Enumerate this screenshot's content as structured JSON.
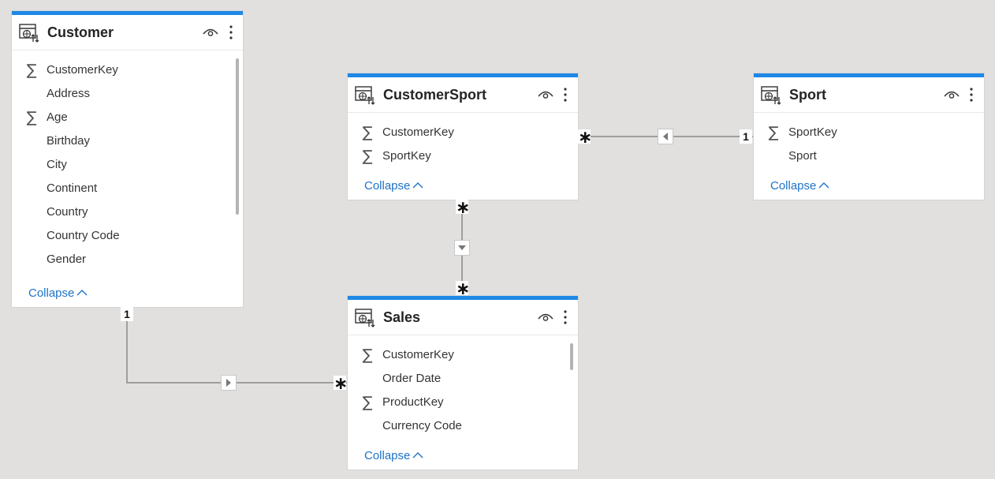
{
  "tables": {
    "customer": {
      "title": "Customer",
      "fields": [
        {
          "name": "CustomerKey",
          "sum": true
        },
        {
          "name": "Address",
          "sum": false
        },
        {
          "name": "Age",
          "sum": true
        },
        {
          "name": "Birthday",
          "sum": false
        },
        {
          "name": "City",
          "sum": false
        },
        {
          "name": "Continent",
          "sum": false
        },
        {
          "name": "Country",
          "sum": false
        },
        {
          "name": "Country Code",
          "sum": false
        },
        {
          "name": "Gender",
          "sum": false
        }
      ],
      "collapse_label": "Collapse"
    },
    "customersport": {
      "title": "CustomerSport",
      "fields": [
        {
          "name": "CustomerKey",
          "sum": true
        },
        {
          "name": "SportKey",
          "sum": true
        }
      ],
      "collapse_label": "Collapse"
    },
    "sport": {
      "title": "Sport",
      "fields": [
        {
          "name": "SportKey",
          "sum": true
        },
        {
          "name": "Sport",
          "sum": false
        }
      ],
      "collapse_label": "Collapse"
    },
    "sales": {
      "title": "Sales",
      "fields": [
        {
          "name": "CustomerKey",
          "sum": true
        },
        {
          "name": "Order Date",
          "sum": false
        },
        {
          "name": "ProductKey",
          "sum": true
        },
        {
          "name": "Currency Code",
          "sum": false
        }
      ],
      "collapse_label": "Collapse"
    }
  },
  "sum_symbol": "∑",
  "relationships": {
    "customersport_sport": {
      "many_label": "∗",
      "one_label": "1"
    },
    "customersport_sales": {
      "many_top_label": "∗",
      "many_bottom_label": "∗"
    },
    "customer_sales": {
      "one_label": "1",
      "many_label": "∗"
    }
  },
  "colors": {
    "header_accent": "#1e88e5",
    "canvas": "#e1e0df",
    "link": "#1e73c8"
  }
}
